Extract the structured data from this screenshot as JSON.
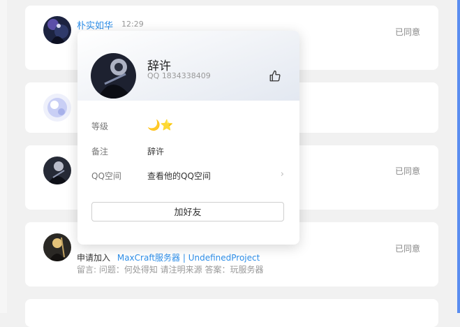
{
  "requests": [
    {
      "name": "朴实如华",
      "time": "12:29",
      "status": "已同意"
    },
    {
      "status": ""
    },
    {
      "status": "已同意"
    },
    {
      "status": "已同意",
      "apply_prefix": "申请加入",
      "group": "MaxCraft服务器 | UndefinedProject",
      "message": "留言: 问题：何处得知 请注明来源 答案：玩服务器"
    }
  ],
  "profile_popup": {
    "name": "辞许",
    "qq": "QQ 1834338409",
    "level_label": "等级",
    "level_icons": "🌙⭐",
    "remark_label": "备注",
    "remark_value": "辞许",
    "zone_label": "QQ空间",
    "zone_value": "查看他的QQ空间",
    "add_friend_label": "加好友",
    "like_icon": "thumbs-up-icon",
    "chevron_icon": "chevron-right-icon"
  },
  "colors": {
    "accent_blue": "#2d8ee8",
    "page_bg": "#f1f1f1",
    "right_strip": "#5a8df0"
  }
}
